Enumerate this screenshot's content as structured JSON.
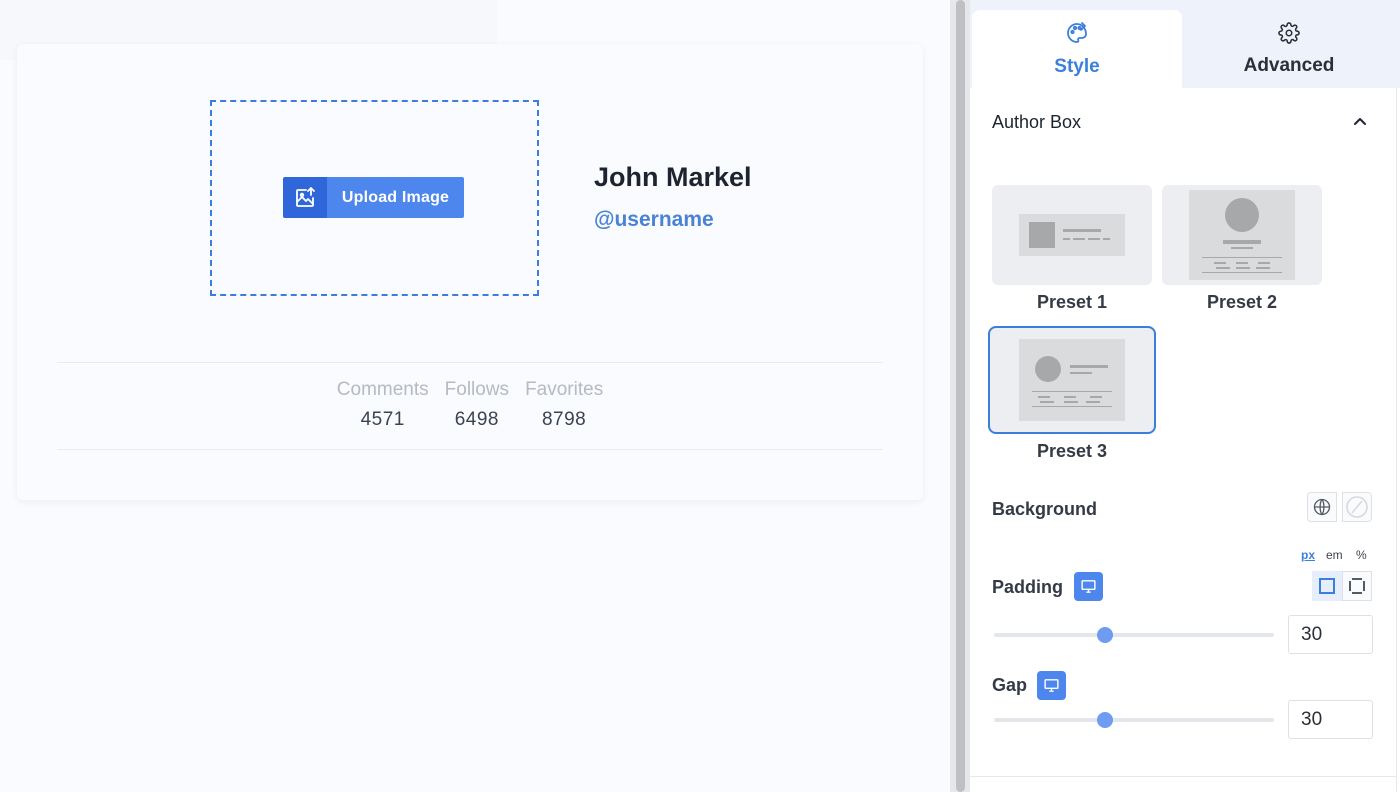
{
  "canvas": {
    "upload_button_label": "Upload Image",
    "author": {
      "name": "John Markel",
      "username": "@username"
    },
    "stats": [
      {
        "label": "Comments",
        "value": "4571"
      },
      {
        "label": "Follows",
        "value": "6498"
      },
      {
        "label": "Favorites",
        "value": "8798"
      }
    ]
  },
  "panel": {
    "tabs": [
      {
        "label": "Style",
        "icon": "palette-icon",
        "active": true
      },
      {
        "label": "Advanced",
        "icon": "gear-icon",
        "active": false
      }
    ],
    "section_title": "Author Box",
    "presets": [
      {
        "label": "Preset 1"
      },
      {
        "label": "Preset 2"
      },
      {
        "label": "Preset 3",
        "selected": true
      }
    ],
    "background_label": "Background",
    "units": [
      "px",
      "em",
      "%"
    ],
    "active_unit": "px",
    "padding": {
      "label": "Padding",
      "value": "30"
    },
    "gap": {
      "label": "Gap",
      "value": "30"
    }
  },
  "colors": {
    "accent": "#3b7fdc",
    "button": "#4d86ec",
    "button_dark": "#2f66d9"
  }
}
